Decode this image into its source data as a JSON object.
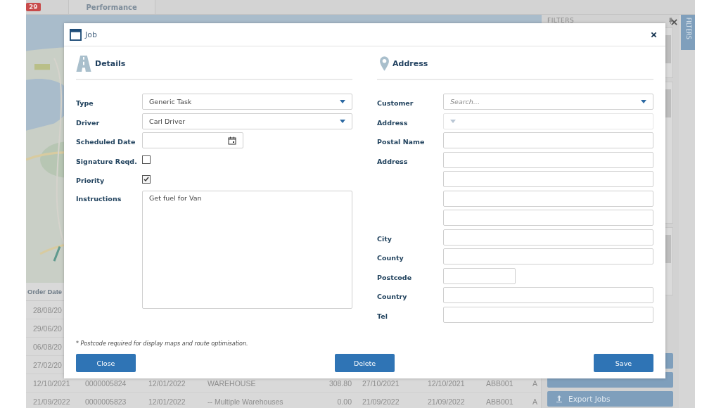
{
  "top_bar": {
    "badge": "29",
    "tabs": [
      {
        "label": "Performance",
        "selected": false
      }
    ]
  },
  "table": {
    "columns": [
      "Order Date"
    ],
    "rows": [
      {
        "cells": [
          "28/08/20"
        ]
      },
      {
        "cells": [
          "29/06/20"
        ]
      },
      {
        "cells": [
          "06/08/20"
        ]
      },
      {
        "cells": [
          "27/02/20"
        ]
      },
      {
        "cells": [
          "12/10/2021",
          "0000005824",
          "12/01/2022",
          "WAREHOUSE",
          "308.80",
          "27/10/2021",
          "12/10/2021",
          "ABB001",
          "A"
        ]
      },
      {
        "cells": [
          "21/09/2022",
          "0000005823",
          "12/01/2022",
          "-- Multiple Warehouses",
          "0.00",
          "21/09/2022",
          "21/09/2022",
          "ABB001",
          "A"
        ]
      }
    ]
  },
  "filters": {
    "title": "FILTERS",
    "side_tab": "FILTERS",
    "buttons": [
      "Export Jobs"
    ]
  },
  "dialog": {
    "title": "Job",
    "details": {
      "heading": "Details",
      "fields": [
        {
          "kind": "select",
          "label": "Type",
          "value": "Generic Task",
          "disabled": false
        },
        {
          "kind": "select",
          "label": "Driver",
          "value": "Carl Driver",
          "disabled": false
        },
        {
          "kind": "date",
          "label": "Scheduled Date"
        },
        {
          "kind": "checkbox",
          "label": "Signature Reqd.",
          "checked": false
        },
        {
          "kind": "checkbox",
          "label": "Priority",
          "checked": true
        },
        {
          "kind": "textarea",
          "label": "Instructions",
          "value": "Get fuel for Van"
        }
      ]
    },
    "address": {
      "heading": "Address",
      "fields": [
        {
          "kind": "select",
          "label": "Customer",
          "placeholder": "Search...",
          "disabled": false
        },
        {
          "kind": "select",
          "label": "Address",
          "disabled": true
        },
        {
          "kind": "text",
          "label": "Postal Name"
        },
        {
          "kind": "text",
          "label": "Address"
        },
        {
          "kind": "text"
        },
        {
          "kind": "text"
        },
        {
          "kind": "text"
        },
        {
          "kind": "text",
          "label": "City"
        },
        {
          "kind": "text",
          "label": "County"
        },
        {
          "kind": "short",
          "label": "Postcode"
        },
        {
          "kind": "text",
          "label": "Country"
        },
        {
          "kind": "text",
          "label": "Tel"
        }
      ]
    },
    "note": "* Postcode required for display maps and route optimisation.",
    "buttons": [
      "Close",
      "Delete",
      "Save"
    ]
  }
}
